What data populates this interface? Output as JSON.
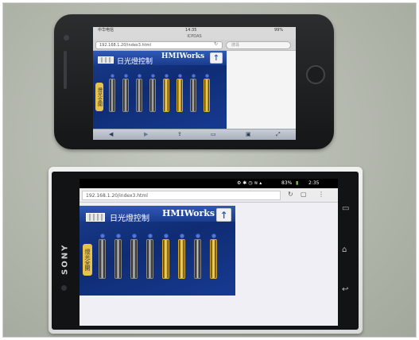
{
  "iphone": {
    "status": {
      "carrier": "中华电信",
      "time": "14:35",
      "battery": "99%"
    },
    "page_title": "ICPDAS",
    "url": "192.168.1.20/index3.html",
    "search_placeholder": "搜尋",
    "toolbar_icons": [
      "back-icon",
      "forward-icon",
      "share-icon",
      "bookmarks-icon",
      "tabs-icon",
      "fullscreen-icon"
    ]
  },
  "sony": {
    "brand": "SONY",
    "status": {
      "battery": "83%",
      "time": "2:35"
    },
    "url": "192.168.1.20/index3.html",
    "nav_icons": [
      "recent-apps-icon",
      "home-icon",
      "back-icon"
    ]
  },
  "hmi": {
    "title": "日光燈控制",
    "logo": "HMIWorks",
    "side_tab": "燈光全開",
    "fixtures": [
      "off",
      "off",
      "off",
      "off",
      "on",
      "on",
      "off",
      "on"
    ],
    "up_arrow": "↑"
  }
}
